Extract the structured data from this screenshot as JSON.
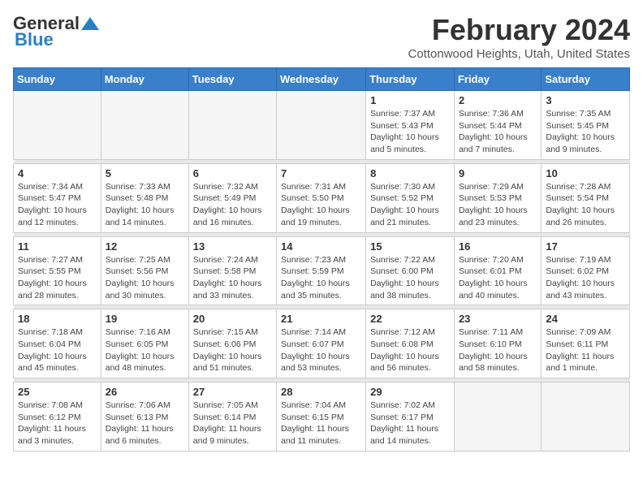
{
  "logo": {
    "general": "General",
    "blue": "Blue"
  },
  "title": "February 2024",
  "subtitle": "Cottonwood Heights, Utah, United States",
  "weekdays": [
    "Sunday",
    "Monday",
    "Tuesday",
    "Wednesday",
    "Thursday",
    "Friday",
    "Saturday"
  ],
  "weeks": [
    [
      {
        "day": "",
        "info": ""
      },
      {
        "day": "",
        "info": ""
      },
      {
        "day": "",
        "info": ""
      },
      {
        "day": "",
        "info": ""
      },
      {
        "day": "1",
        "info": "Sunrise: 7:37 AM\nSunset: 5:43 PM\nDaylight: 10 hours and 5 minutes."
      },
      {
        "day": "2",
        "info": "Sunrise: 7:36 AM\nSunset: 5:44 PM\nDaylight: 10 hours and 7 minutes."
      },
      {
        "day": "3",
        "info": "Sunrise: 7:35 AM\nSunset: 5:45 PM\nDaylight: 10 hours and 9 minutes."
      }
    ],
    [
      {
        "day": "4",
        "info": "Sunrise: 7:34 AM\nSunset: 5:47 PM\nDaylight: 10 hours and 12 minutes."
      },
      {
        "day": "5",
        "info": "Sunrise: 7:33 AM\nSunset: 5:48 PM\nDaylight: 10 hours and 14 minutes."
      },
      {
        "day": "6",
        "info": "Sunrise: 7:32 AM\nSunset: 5:49 PM\nDaylight: 10 hours and 16 minutes."
      },
      {
        "day": "7",
        "info": "Sunrise: 7:31 AM\nSunset: 5:50 PM\nDaylight: 10 hours and 19 minutes."
      },
      {
        "day": "8",
        "info": "Sunrise: 7:30 AM\nSunset: 5:52 PM\nDaylight: 10 hours and 21 minutes."
      },
      {
        "day": "9",
        "info": "Sunrise: 7:29 AM\nSunset: 5:53 PM\nDaylight: 10 hours and 23 minutes."
      },
      {
        "day": "10",
        "info": "Sunrise: 7:28 AM\nSunset: 5:54 PM\nDaylight: 10 hours and 26 minutes."
      }
    ],
    [
      {
        "day": "11",
        "info": "Sunrise: 7:27 AM\nSunset: 5:55 PM\nDaylight: 10 hours and 28 minutes."
      },
      {
        "day": "12",
        "info": "Sunrise: 7:25 AM\nSunset: 5:56 PM\nDaylight: 10 hours and 30 minutes."
      },
      {
        "day": "13",
        "info": "Sunrise: 7:24 AM\nSunset: 5:58 PM\nDaylight: 10 hours and 33 minutes."
      },
      {
        "day": "14",
        "info": "Sunrise: 7:23 AM\nSunset: 5:59 PM\nDaylight: 10 hours and 35 minutes."
      },
      {
        "day": "15",
        "info": "Sunrise: 7:22 AM\nSunset: 6:00 PM\nDaylight: 10 hours and 38 minutes."
      },
      {
        "day": "16",
        "info": "Sunrise: 7:20 AM\nSunset: 6:01 PM\nDaylight: 10 hours and 40 minutes."
      },
      {
        "day": "17",
        "info": "Sunrise: 7:19 AM\nSunset: 6:02 PM\nDaylight: 10 hours and 43 minutes."
      }
    ],
    [
      {
        "day": "18",
        "info": "Sunrise: 7:18 AM\nSunset: 6:04 PM\nDaylight: 10 hours and 45 minutes."
      },
      {
        "day": "19",
        "info": "Sunrise: 7:16 AM\nSunset: 6:05 PM\nDaylight: 10 hours and 48 minutes."
      },
      {
        "day": "20",
        "info": "Sunrise: 7:15 AM\nSunset: 6:06 PM\nDaylight: 10 hours and 51 minutes."
      },
      {
        "day": "21",
        "info": "Sunrise: 7:14 AM\nSunset: 6:07 PM\nDaylight: 10 hours and 53 minutes."
      },
      {
        "day": "22",
        "info": "Sunrise: 7:12 AM\nSunset: 6:08 PM\nDaylight: 10 hours and 56 minutes."
      },
      {
        "day": "23",
        "info": "Sunrise: 7:11 AM\nSunset: 6:10 PM\nDaylight: 10 hours and 58 minutes."
      },
      {
        "day": "24",
        "info": "Sunrise: 7:09 AM\nSunset: 6:11 PM\nDaylight: 11 hours and 1 minute."
      }
    ],
    [
      {
        "day": "25",
        "info": "Sunrise: 7:08 AM\nSunset: 6:12 PM\nDaylight: 11 hours and 3 minutes."
      },
      {
        "day": "26",
        "info": "Sunrise: 7:06 AM\nSunset: 6:13 PM\nDaylight: 11 hours and 6 minutes."
      },
      {
        "day": "27",
        "info": "Sunrise: 7:05 AM\nSunset: 6:14 PM\nDaylight: 11 hours and 9 minutes."
      },
      {
        "day": "28",
        "info": "Sunrise: 7:04 AM\nSunset: 6:15 PM\nDaylight: 11 hours and 11 minutes."
      },
      {
        "day": "29",
        "info": "Sunrise: 7:02 AM\nSunset: 6:17 PM\nDaylight: 11 hours and 14 minutes."
      },
      {
        "day": "",
        "info": ""
      },
      {
        "day": "",
        "info": ""
      }
    ]
  ]
}
